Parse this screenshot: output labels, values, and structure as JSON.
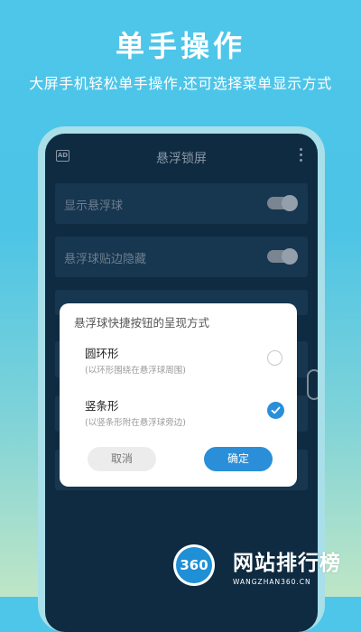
{
  "promo": {
    "title": "单手操作",
    "subtitle": "大屏手机轻松单手操作,还可选择菜单显示方式"
  },
  "app": {
    "title": "悬浮锁屏",
    "ad_icon_text": "AD",
    "settings": [
      {
        "label": "显示悬浮球",
        "toggle_on": true
      },
      {
        "label": "悬浮球贴边隐藏",
        "toggle_on": true
      }
    ]
  },
  "dialog": {
    "title": "悬浮球快捷按钮的呈现方式",
    "options": [
      {
        "title": "圆环形",
        "desc": "(以环形围绕在悬浮球周围)",
        "selected": false
      },
      {
        "title": "竖条形",
        "desc": "(以竖条形附在悬浮球旁边)",
        "selected": true
      }
    ],
    "cancel_label": "取消",
    "ok_label": "确定"
  },
  "watermark": {
    "logo_text": "360",
    "name": "网站排行榜",
    "url": "WANGZHAN360.CN"
  },
  "colors": {
    "accent": "#2a8fd8",
    "screen_bg": "#0e2b42"
  },
  "icons": [
    "ad-icon",
    "more-vertical-icon",
    "check-icon"
  ]
}
